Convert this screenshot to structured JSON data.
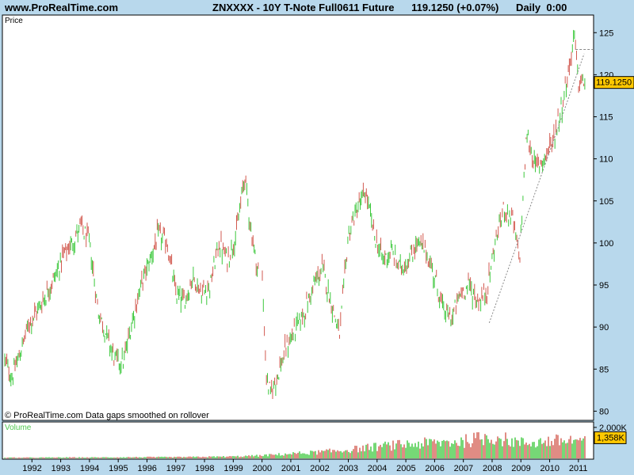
{
  "header": {
    "site": "www.ProRealTime.com",
    "title": "ZNXXXX - 10Y T-Note Full0611 Future      119.1250 (+0.07%)      Daily  0:00"
  },
  "price_panel": {
    "label": "Price",
    "footer": "© ProRealTime.com  Data gaps smoothed on rollover",
    "last_price_label": "119.1250"
  },
  "volume_panel": {
    "label": "Volume",
    "last_volume_label": "1,358K"
  },
  "colors": {
    "up": "#3CC83C",
    "down": "#D25A50",
    "background": "#FFFFFF",
    "frame": "#B8D8EC",
    "price_tag": "#FFC800"
  },
  "chart_data": [
    {
      "type": "line",
      "title": "ZNXXXX - 10Y T-Note Full0611 Future",
      "ylabel": "Price",
      "x": [
        "1992",
        "1993",
        "1994",
        "1995",
        "1996",
        "1997",
        "1998",
        "1999",
        "2000",
        "2001",
        "2002",
        "2003",
        "2004",
        "2005",
        "2006",
        "2007",
        "2008",
        "2009",
        "2010",
        "2011"
      ],
      "ylim": [
        79,
        127
      ],
      "yticks": [
        80,
        85,
        90,
        95,
        100,
        105,
        110,
        115,
        120,
        125
      ],
      "series": [
        {
          "x": [
            1991.0,
            1991.3,
            1991.6,
            1991.9,
            1992.2,
            1992.5,
            1992.8,
            1993.1,
            1993.4,
            1993.7,
            1994.0,
            1994.3,
            1994.6,
            1994.9,
            1995.2,
            1995.5,
            1995.8,
            1996.1,
            1996.4,
            1996.7,
            1997.0,
            1997.3,
            1997.6,
            1997.9,
            1998.2,
            1998.5,
            1998.8,
            1999.1,
            1999.4,
            1999.6,
            1999.83,
            2000.0,
            2000.15,
            2000.3,
            2000.6,
            2000.9,
            2001.2,
            2001.5,
            2001.8,
            2002.1,
            2002.4,
            2002.7,
            2003.0,
            2003.3,
            2003.6,
            2003.9,
            2004.2,
            2004.5,
            2004.8,
            2005.1,
            2005.4,
            2005.7,
            2006.0,
            2006.3,
            2006.6,
            2006.9,
            2007.2,
            2007.5,
            2007.8,
            2008.1,
            2008.4,
            2008.7,
            2008.95,
            2009.2,
            2009.5,
            2009.8,
            2010.1,
            2010.4,
            2010.7,
            2010.85,
            2011.0,
            2011.2
          ],
          "y": [
            86.5,
            84,
            87,
            90.5,
            92,
            94,
            96,
            98.5,
            100,
            102,
            100,
            92,
            89,
            86,
            86,
            91,
            95,
            98,
            101,
            100,
            94,
            93,
            96,
            94,
            95,
            100,
            98,
            101,
            108,
            102,
            97,
            96.5,
            84,
            82,
            85,
            88,
            90,
            92,
            95,
            97,
            93,
            89,
            101,
            104,
            106,
            101,
            98,
            99,
            97,
            98,
            100,
            99,
            96,
            92,
            91,
            94,
            95,
            93,
            94,
            100,
            104,
            103,
            98,
            113,
            109,
            110,
            112,
            116,
            121,
            125,
            119,
            119.1
          ]
        }
      ],
      "trendline": {
        "from": [
          2007.9,
          90.5
        ],
        "to": [
          2011.2,
          122.5
        ]
      },
      "resistance_line": 123,
      "last_price": 119.125
    },
    {
      "type": "bar",
      "title": "Volume",
      "x": [
        "1992",
        "1993",
        "1994",
        "1995",
        "1996",
        "1997",
        "1998",
        "1999",
        "2000",
        "2001",
        "2002",
        "2003",
        "2004",
        "2005",
        "2006",
        "2007",
        "2008",
        "2009",
        "2010",
        "2011"
      ],
      "ytick_labels": [
        "2,000K",
        "1,358K"
      ],
      "series": [
        {
          "name": "Volume",
          "x": [
            1991,
            1992,
            1993,
            1994,
            1995,
            1996,
            1997,
            1998,
            1999,
            2000,
            2001,
            2002,
            2003,
            2004,
            2005,
            2006,
            2007,
            2008,
            2009,
            2010,
            2011.2
          ],
          "y": [
            0.05,
            0.05,
            0.06,
            0.06,
            0.07,
            0.08,
            0.08,
            0.1,
            0.12,
            0.18,
            0.3,
            0.4,
            0.55,
            0.75,
            0.9,
            1.0,
            1.1,
            1.4,
            1.0,
            1.1,
            1.2
          ]
        }
      ],
      "last_volume": 1.358
    }
  ]
}
